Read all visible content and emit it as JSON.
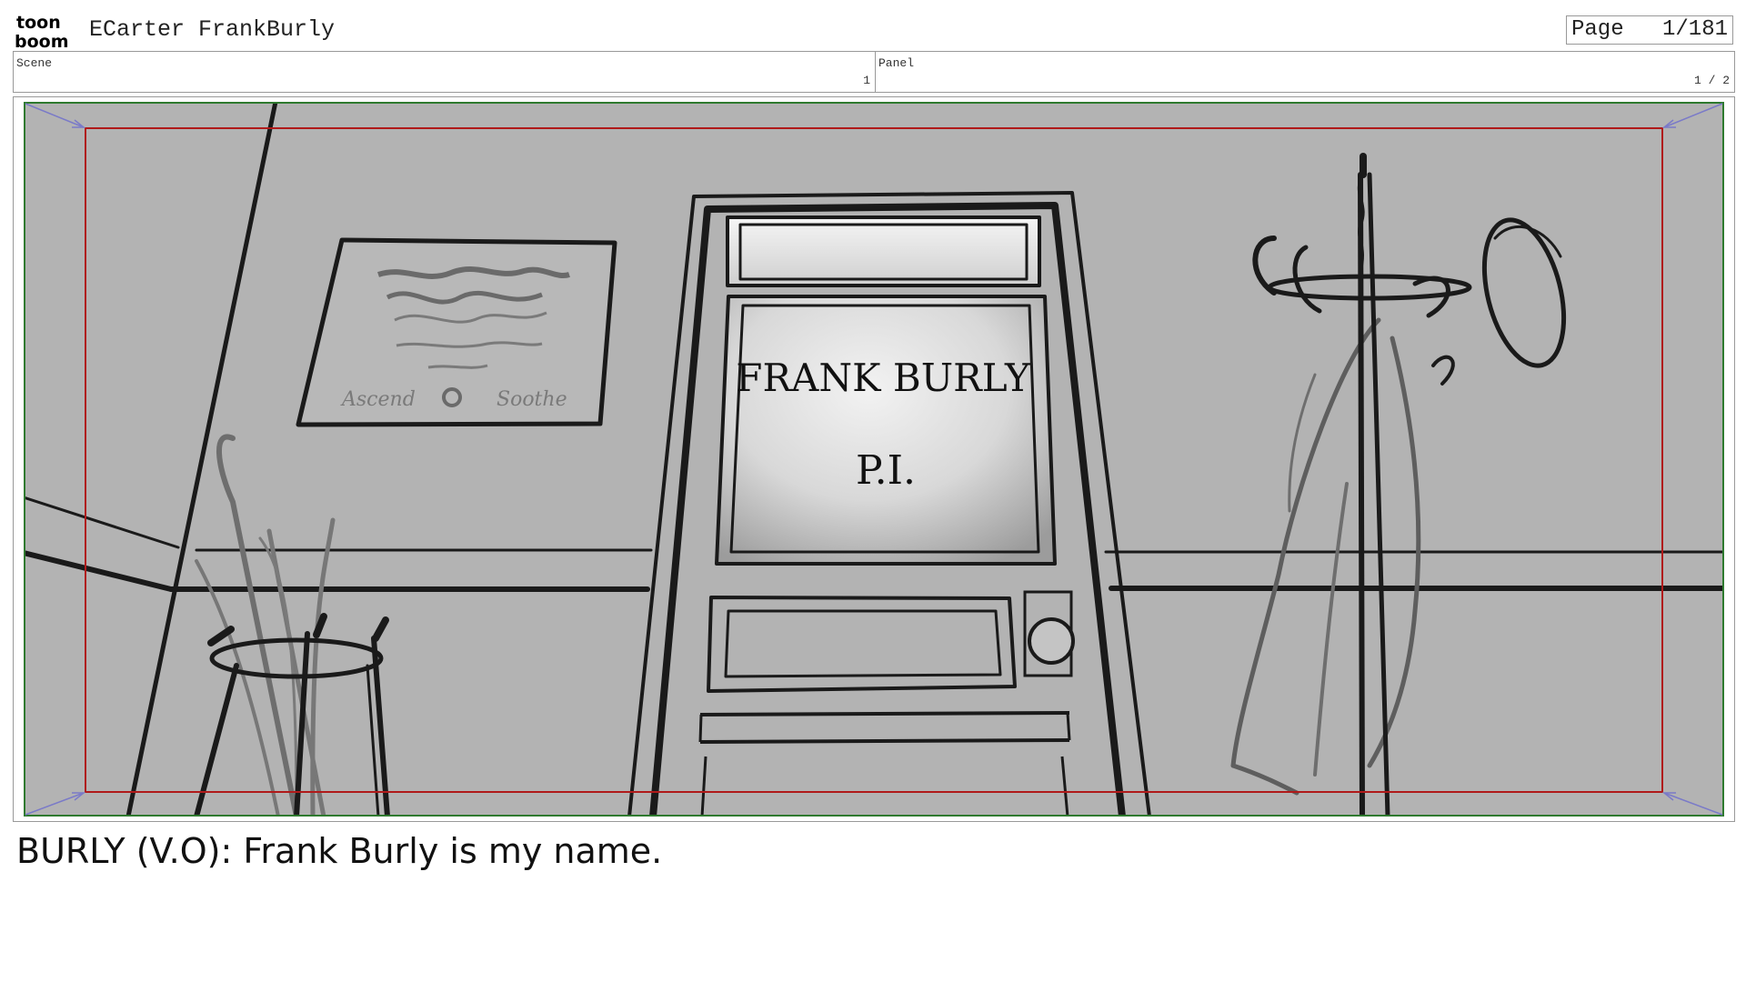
{
  "header": {
    "logo_top": "toon",
    "logo_bottom": "boom",
    "project_title": "ECarter FrankBurly",
    "page_label": "Page",
    "page_value": "1/181"
  },
  "info": {
    "scene_label": "Scene",
    "scene_value": "1",
    "panel_label": "Panel",
    "panel_value": "1 / 2"
  },
  "drawing": {
    "door_sign_name": "FRANK BURLY",
    "door_sign_title": "P.I.",
    "poster_left": "Ascend",
    "poster_right": "Soothe"
  },
  "caption": "BURLY (V.O): Frank Burly is my name.",
  "colors": {
    "background": "#b3b3b3",
    "safe_frame": "#b01a1a",
    "camera_frame": "#2f7a2f",
    "camera_arrows": "#7a7ac8"
  }
}
